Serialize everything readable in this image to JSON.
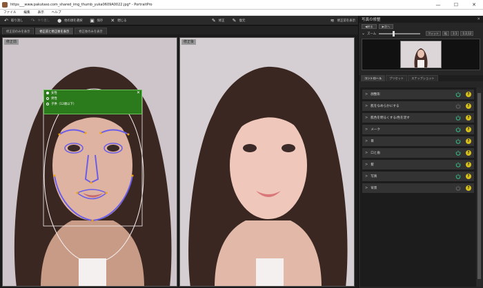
{
  "window": {
    "title": "https___www.pakutaso.com_shared_img_thumb_yuka0609A0022.jpg* - PortraitPro",
    "minimize": "—",
    "maximize": "☐",
    "close": "✕"
  },
  "menu": [
    "ファイル",
    "編集",
    "表示",
    "ヘルプ"
  ],
  "toolbar": {
    "undo": "取り消し",
    "redo": "やり直し",
    "select_face": "他の顔を選択",
    "save": "保存",
    "close": "閉じる",
    "edit_mode": "修正",
    "restore_mode": "復元",
    "compare": "修正前を表示"
  },
  "tabs": [
    "修正前のみを表示",
    "修正前と修正後を表示",
    "修正後のみを表示"
  ],
  "panes": {
    "before_label": "修正前",
    "after_label": "修正後"
  },
  "popup": {
    "options": [
      "女性",
      "男性",
      "子供（12歳以下）"
    ],
    "selected": 0,
    "close": "✕"
  },
  "sidebar": {
    "title": "写真の修整",
    "close": "✕",
    "buttons": [
      "戻る",
      "次へ"
    ],
    "zoom_label": "ズーム",
    "zoom_level": 0.35,
    "fit": "フィット",
    "mag": "拡",
    "one_to_one": "1:1",
    "ratio": "1:2,12",
    "control_tabs": [
      "コントロール",
      "プリセット",
      "スナップショット"
    ],
    "controls": [
      {
        "name": "顔整形",
        "active": true
      },
      {
        "name": "肌をなめらかにする",
        "active": false
      },
      {
        "name": "肌色を明るくする/色を足す",
        "active": true
      },
      {
        "name": "メーク",
        "active": true
      },
      {
        "name": "目",
        "active": true
      },
      {
        "name": "口と歯",
        "active": true
      },
      {
        "name": "髪",
        "active": true
      },
      {
        "name": "写真",
        "active": true
      },
      {
        "name": "背景",
        "active": false
      }
    ]
  },
  "colors": {
    "accent_green": "#2b7a1b",
    "power_active": "#35c28a",
    "help_yellow": "#d8c01a",
    "face_mesh": "#6a5de8"
  },
  "icons": {
    "undo": "undo-icon",
    "redo": "redo-icon",
    "person": "person-icon",
    "save": "save-icon",
    "close": "close-icon",
    "brush": "brush-icon",
    "layers": "layers-icon"
  }
}
